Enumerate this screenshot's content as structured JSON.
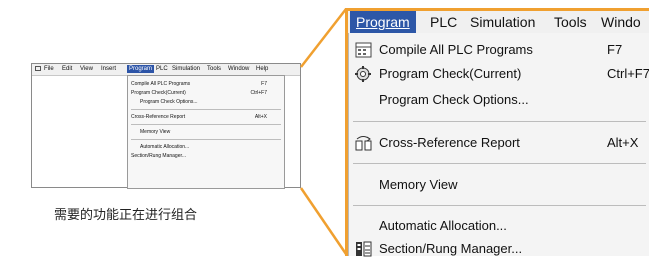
{
  "thumbnail": {
    "menubar": [
      "File",
      "Edit",
      "View",
      "Insert",
      "Program",
      "PLC",
      "Simulation",
      "Tools",
      "Window",
      "Help"
    ],
    "menu_items": [
      {
        "label": "Compile All PLC Programs",
        "shortcut": "F7"
      },
      {
        "label": "Program Check(Current)",
        "shortcut": "Ctrl+F7"
      },
      {
        "label": "Program Check Options...",
        "shortcut": ""
      },
      {
        "label": "Cross-Reference Report",
        "shortcut": "Alt+X"
      },
      {
        "label": "Memory View",
        "shortcut": ""
      },
      {
        "label": "Automatic Allocation...",
        "shortcut": ""
      },
      {
        "label": "Section/Rung Manager...",
        "shortcut": ""
      }
    ]
  },
  "caption": "需要的功能正在进行组合",
  "zoom": {
    "menubar": [
      "Program",
      "PLC",
      "Simulation",
      "Tools",
      "Windo"
    ],
    "menu_items": [
      {
        "label": "Compile All PLC Programs",
        "shortcut": "F7",
        "icon": "compile-icon"
      },
      {
        "label": "Program Check(Current)",
        "shortcut": "Ctrl+F7",
        "icon": "program-check-icon"
      },
      {
        "label": "Program Check Options...",
        "shortcut": ""
      },
      {
        "label": "Cross-Reference Report",
        "shortcut": "Alt+X",
        "icon": "cross-reference-icon"
      },
      {
        "label": "Memory View",
        "shortcut": ""
      },
      {
        "label": "Automatic Allocation...",
        "shortcut": ""
      },
      {
        "label": "Section/Rung Manager...",
        "shortcut": "",
        "icon": "section-manager-icon"
      }
    ]
  },
  "colors": {
    "highlight": "#2d57a7",
    "frame": "#f0a030",
    "menu_bg": "#f4f4f4"
  }
}
